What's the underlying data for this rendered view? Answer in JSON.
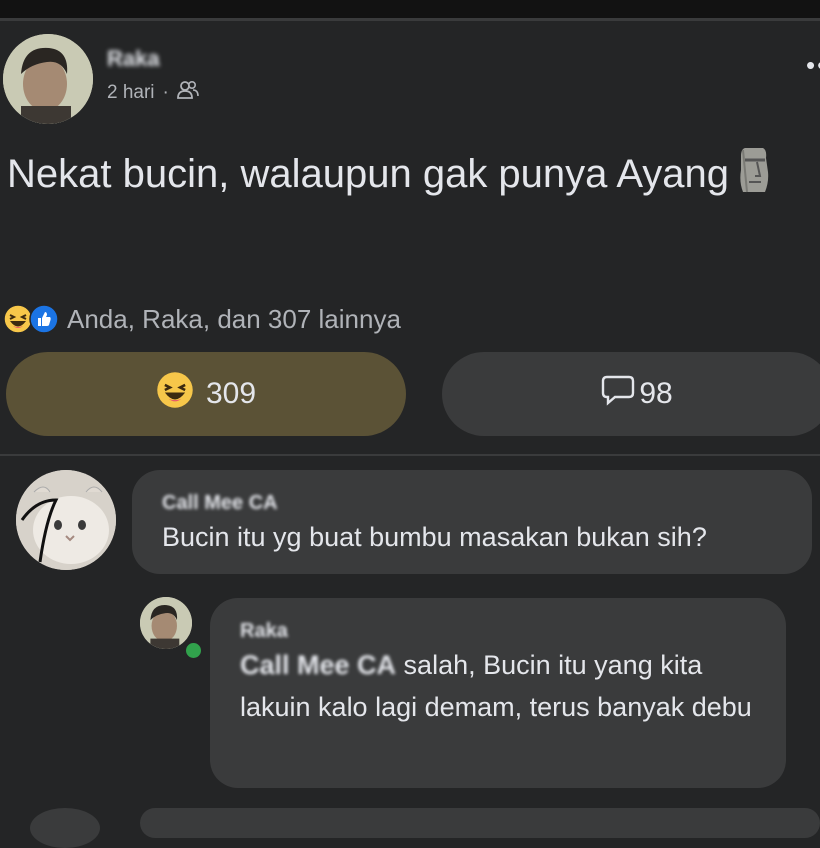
{
  "post": {
    "author": "Raka",
    "time": "2 hari",
    "audience_icon": "friends-icon",
    "more_label": "••",
    "text": "Nekat bucin, walaupun gak punya Ayang",
    "emoji": "moai"
  },
  "reactions": {
    "icons": [
      "haha-icon",
      "like-icon"
    ],
    "summary": "Anda, Raka, dan 307 lainnya",
    "haha_count": "309",
    "comment_count": "98",
    "colors": {
      "haha_active_bg": "#5b5236",
      "button_bg": "#3a3b3c"
    }
  },
  "comments": [
    {
      "author": "Call Mee CA",
      "text": "Bucin itu yg buat bumbu masakan bukan sih?"
    },
    {
      "author": "Raka",
      "mention": "Call Mee CA",
      "text": " salah, Bucin itu yang kita lakuin kalo lagi demam, terus banyak debu",
      "online": true
    }
  ]
}
